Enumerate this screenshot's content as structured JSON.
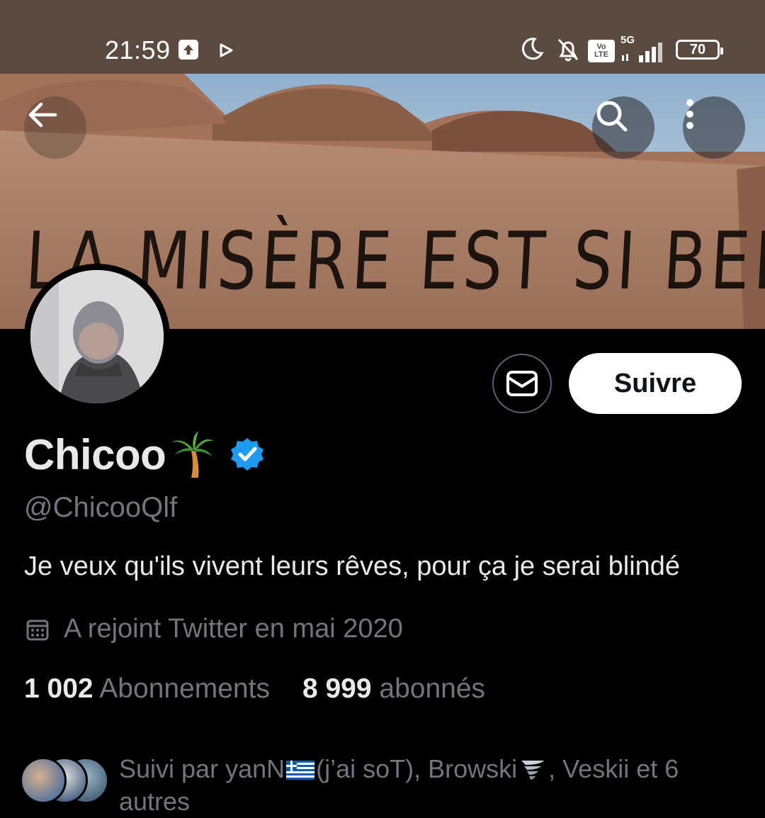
{
  "status_bar": {
    "time": "21:59",
    "network": "5G",
    "volte_label_1": "Vo",
    "volte_label_2": "LTE",
    "battery": "70",
    "icons": [
      "upload-icon",
      "play-icon",
      "moon-icon",
      "bell-off-icon",
      "volte-icon",
      "signal-icon",
      "battery-icon"
    ]
  },
  "banner": {
    "text": "LA MISÈRE EST SI BELLE"
  },
  "header_buttons": {
    "back_icon": "arrow-left-icon",
    "search_icon": "search-icon",
    "more_icon": "more-vertical-icon"
  },
  "profile": {
    "display_name": "Chicoo",
    "name_emoji": "palm-tree",
    "verified": true,
    "handle": "@ChicooQlf",
    "bio": "Je veux qu'ils vivent leurs rêves, pour ça je serai blindé",
    "joined": "A rejoint Twitter en mai 2020",
    "following_count": "1 002",
    "following_label": "Abonnements",
    "followers_count": "8 999",
    "followers_label": "abonnés",
    "followed_by_prefix": "Suivi par yanN",
    "followed_by_mid": "(j’ai soT), Browski",
    "followed_by_suffix": ", Veskii et 6 autres"
  },
  "actions": {
    "message_icon": "envelope-icon",
    "follow_label": "Suivre"
  },
  "colors": {
    "background": "#000000",
    "status_bar": "#5b4a40",
    "text_primary": "#e7e9ea",
    "text_secondary": "#71767b",
    "verified_blue": "#1d9bf0",
    "button_border": "#536471"
  }
}
